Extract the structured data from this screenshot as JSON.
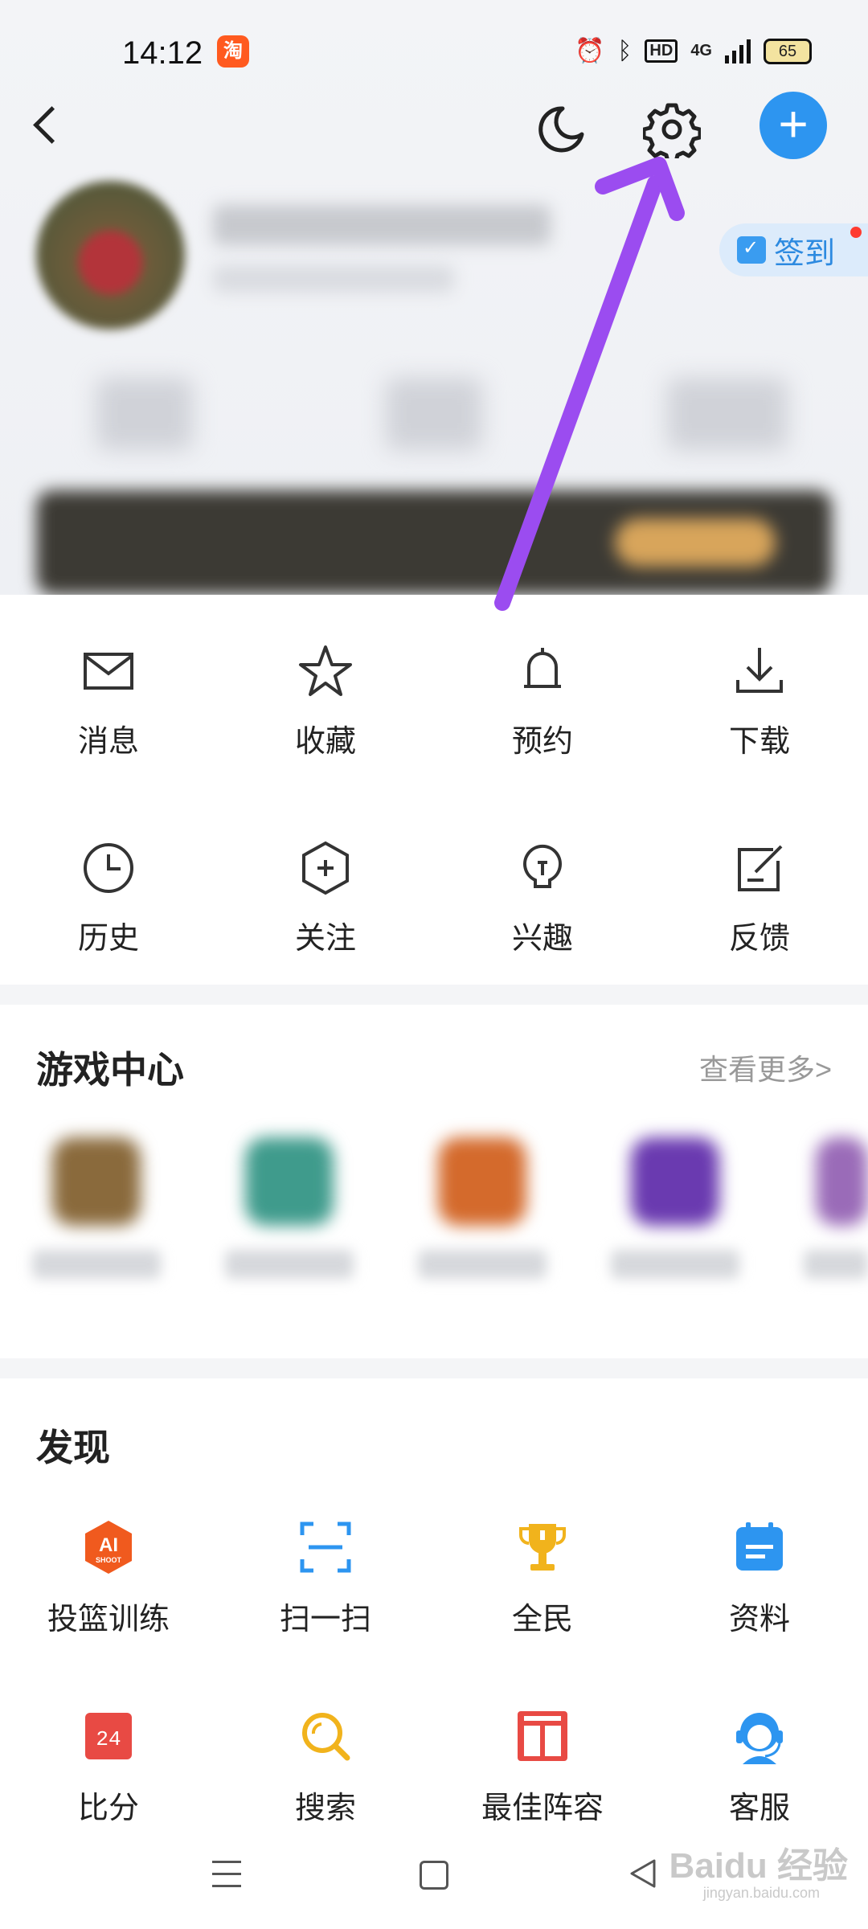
{
  "status_bar": {
    "time": "14:12",
    "app_badge": "淘",
    "hd": "HD",
    "network": "4G",
    "battery": "65"
  },
  "header": {
    "checkin_label": "签到"
  },
  "menu": {
    "items": [
      {
        "label": "消息",
        "icon": "mail-icon"
      },
      {
        "label": "收藏",
        "icon": "star-icon"
      },
      {
        "label": "预约",
        "icon": "bell-icon"
      },
      {
        "label": "下载",
        "icon": "download-icon"
      },
      {
        "label": "历史",
        "icon": "clock-icon"
      },
      {
        "label": "关注",
        "icon": "hexagon-plus-icon"
      },
      {
        "label": "兴趣",
        "icon": "bulb-icon"
      },
      {
        "label": "反馈",
        "icon": "edit-icon"
      }
    ]
  },
  "games": {
    "title": "游戏中心",
    "more": "查看更多>"
  },
  "discover": {
    "title": "发现",
    "items": [
      {
        "label": "投篮训练",
        "icon": "ai-shoot-icon"
      },
      {
        "label": "扫一扫",
        "icon": "scan-icon"
      },
      {
        "label": "全民",
        "icon": "trophy-icon"
      },
      {
        "label": "资料",
        "icon": "calendar-icon"
      },
      {
        "label": "比分",
        "icon": "score-24-icon"
      },
      {
        "label": "搜索",
        "icon": "search-icon"
      },
      {
        "label": "最佳阵容",
        "icon": "lineup-icon"
      },
      {
        "label": "客服",
        "icon": "customer-service-icon"
      }
    ],
    "ai_badge": "AI",
    "ai_sub": "SHOOT",
    "score_badge": "24"
  },
  "watermark": {
    "brand": "Baidu 经验",
    "url": "jingyan.baidu.com"
  },
  "colors": {
    "accent_blue": "#2d95f0",
    "annotation_purple": "#9b4cf0"
  }
}
